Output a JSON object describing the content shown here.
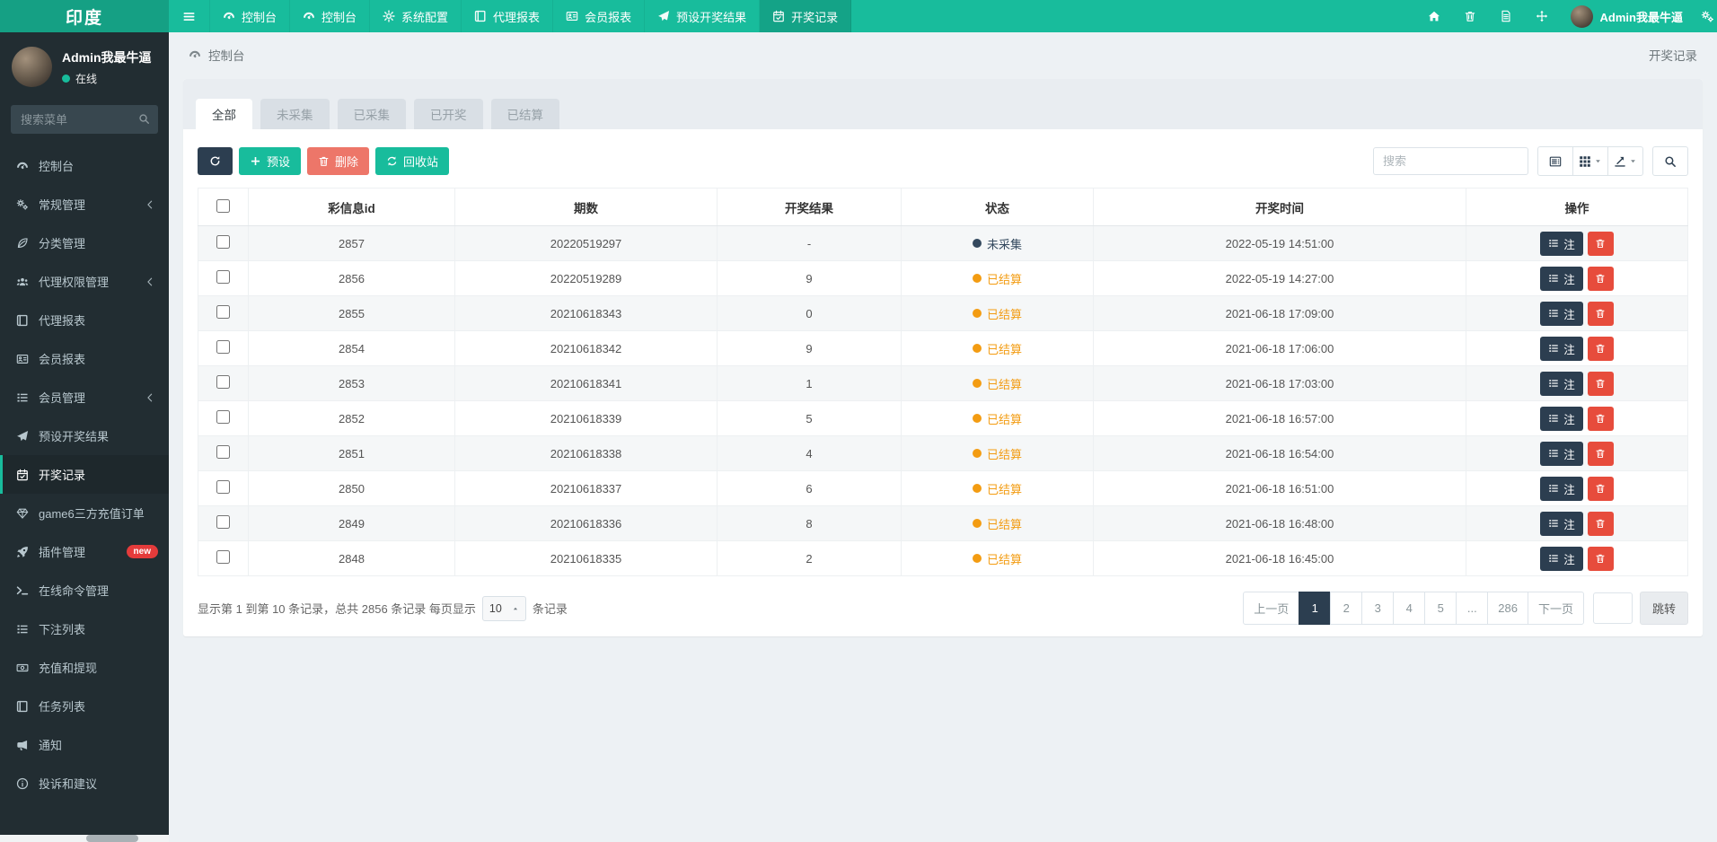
{
  "colors": {
    "teal": "#18bc9c",
    "teal_dark": "#15a084",
    "navy": "#2c3e50",
    "danger": "#e74c3c",
    "danger_light": "#ed7669",
    "warning": "#f39c12",
    "sidebar_bg": "#222d32",
    "page_bg": "#edf1f4"
  },
  "navbar": {
    "brand": "印度",
    "items": [
      {
        "name": "dashboard-1",
        "label": "控制台",
        "icon": "tachometer"
      },
      {
        "name": "dashboard-2",
        "label": "控制台",
        "icon": "tachometer"
      },
      {
        "name": "system-config",
        "label": "系统配置",
        "icon": "gear"
      },
      {
        "name": "agent-report",
        "label": "代理报表",
        "icon": "book"
      },
      {
        "name": "member-report",
        "label": "会员报表",
        "icon": "id-card"
      },
      {
        "name": "preset-lottery-results",
        "label": "预设开奖结果",
        "icon": "send"
      },
      {
        "name": "lottery-records",
        "label": "开奖记录",
        "icon": "calendar",
        "active": true
      }
    ],
    "right_icons": [
      {
        "name": "home",
        "icon": "home"
      },
      {
        "name": "trash",
        "icon": "trash"
      },
      {
        "name": "clear-cache",
        "icon": "file"
      },
      {
        "name": "fullscreen",
        "icon": "expand"
      }
    ],
    "user": {
      "name": "Admin我最牛逼"
    }
  },
  "sidebar": {
    "user": {
      "name": "Admin我最牛逼",
      "status": "在线"
    },
    "search_placeholder": "搜索菜单",
    "items": [
      {
        "name": "dashboard",
        "label": "控制台",
        "icon": "tachometer"
      },
      {
        "name": "general-management",
        "label": "常规管理",
        "icon": "cogs",
        "chevron": true
      },
      {
        "name": "category-management",
        "label": "分类管理",
        "icon": "leaf"
      },
      {
        "name": "agent-permission",
        "label": "代理权限管理",
        "icon": "users",
        "chevron": true
      },
      {
        "name": "agent-report",
        "label": "代理报表",
        "icon": "book"
      },
      {
        "name": "member-report",
        "label": "会员报表",
        "icon": "id-card"
      },
      {
        "name": "member-management",
        "label": "会员管理",
        "icon": "list",
        "chevron": true
      },
      {
        "name": "preset-lottery-results",
        "label": "预设开奖结果",
        "icon": "send"
      },
      {
        "name": "lottery-records",
        "label": "开奖记录",
        "icon": "calendar",
        "active": true
      },
      {
        "name": "game6-recharge-orders",
        "label": "game6三方充值订单",
        "icon": "gem"
      },
      {
        "name": "plugin-management",
        "label": "插件管理",
        "icon": "rocket",
        "badge": "new"
      },
      {
        "name": "online-command",
        "label": "在线命令管理",
        "icon": "terminal"
      },
      {
        "name": "bet-list",
        "label": "下注列表",
        "icon": "list"
      },
      {
        "name": "recharge-withdraw",
        "label": "充值和提现",
        "icon": "money"
      },
      {
        "name": "task-list",
        "label": "任务列表",
        "icon": "book"
      },
      {
        "name": "notice",
        "label": "通知",
        "icon": "bullhorn"
      },
      {
        "name": "complaints-suggestions",
        "label": "投诉和建议",
        "icon": "info"
      }
    ]
  },
  "breadcrumb": {
    "left": "控制台",
    "right": "开奖记录"
  },
  "tabs": [
    {
      "label": "全部",
      "active": true
    },
    {
      "label": "未采集"
    },
    {
      "label": "已采集"
    },
    {
      "label": "已开奖"
    },
    {
      "label": "已结算"
    }
  ],
  "toolbar": {
    "preset_label": "预设",
    "delete_label": "删除",
    "recycle_label": "回收站",
    "search_placeholder": "搜索"
  },
  "table": {
    "columns": [
      "彩信息id",
      "期数",
      "开奖结果",
      "状态",
      "开奖时间",
      "操作"
    ],
    "note_label": "注",
    "rows": [
      {
        "id": "2857",
        "period": "20220519297",
        "result": "-",
        "status": "未采集",
        "status_type": "pending",
        "time": "2022-05-19 14:51:00"
      },
      {
        "id": "2856",
        "period": "20220519289",
        "result": "9",
        "status": "已结算",
        "status_type": "settled",
        "time": "2022-05-19 14:27:00"
      },
      {
        "id": "2855",
        "period": "20210618343",
        "result": "0",
        "status": "已结算",
        "status_type": "settled",
        "time": "2021-06-18 17:09:00"
      },
      {
        "id": "2854",
        "period": "20210618342",
        "result": "9",
        "status": "已结算",
        "status_type": "settled",
        "time": "2021-06-18 17:06:00"
      },
      {
        "id": "2853",
        "period": "20210618341",
        "result": "1",
        "status": "已结算",
        "status_type": "settled",
        "time": "2021-06-18 17:03:00"
      },
      {
        "id": "2852",
        "period": "20210618339",
        "result": "5",
        "status": "已结算",
        "status_type": "settled",
        "time": "2021-06-18 16:57:00"
      },
      {
        "id": "2851",
        "period": "20210618338",
        "result": "4",
        "status": "已结算",
        "status_type": "settled",
        "time": "2021-06-18 16:54:00"
      },
      {
        "id": "2850",
        "period": "20210618337",
        "result": "6",
        "status": "已结算",
        "status_type": "settled",
        "time": "2021-06-18 16:51:00"
      },
      {
        "id": "2849",
        "period": "20210618336",
        "result": "8",
        "status": "已结算",
        "status_type": "settled",
        "time": "2021-06-18 16:48:00"
      },
      {
        "id": "2848",
        "period": "20210618335",
        "result": "2",
        "status": "已结算",
        "status_type": "settled",
        "time": "2021-06-18 16:45:00"
      }
    ]
  },
  "pagination": {
    "summary_prefix": "显示第 1 到第 10 条记录，总共 2856 条记录 每页显示",
    "page_size": "10",
    "summary_suffix": "条记录",
    "pages": [
      {
        "label": "上一页",
        "name": "prev"
      },
      {
        "label": "1",
        "active": true
      },
      {
        "label": "2"
      },
      {
        "label": "3"
      },
      {
        "label": "4"
      },
      {
        "label": "5"
      },
      {
        "label": "...",
        "ellipsis": true
      },
      {
        "label": "286"
      },
      {
        "label": "下一页",
        "name": "next"
      }
    ],
    "jump_label": "跳转"
  }
}
